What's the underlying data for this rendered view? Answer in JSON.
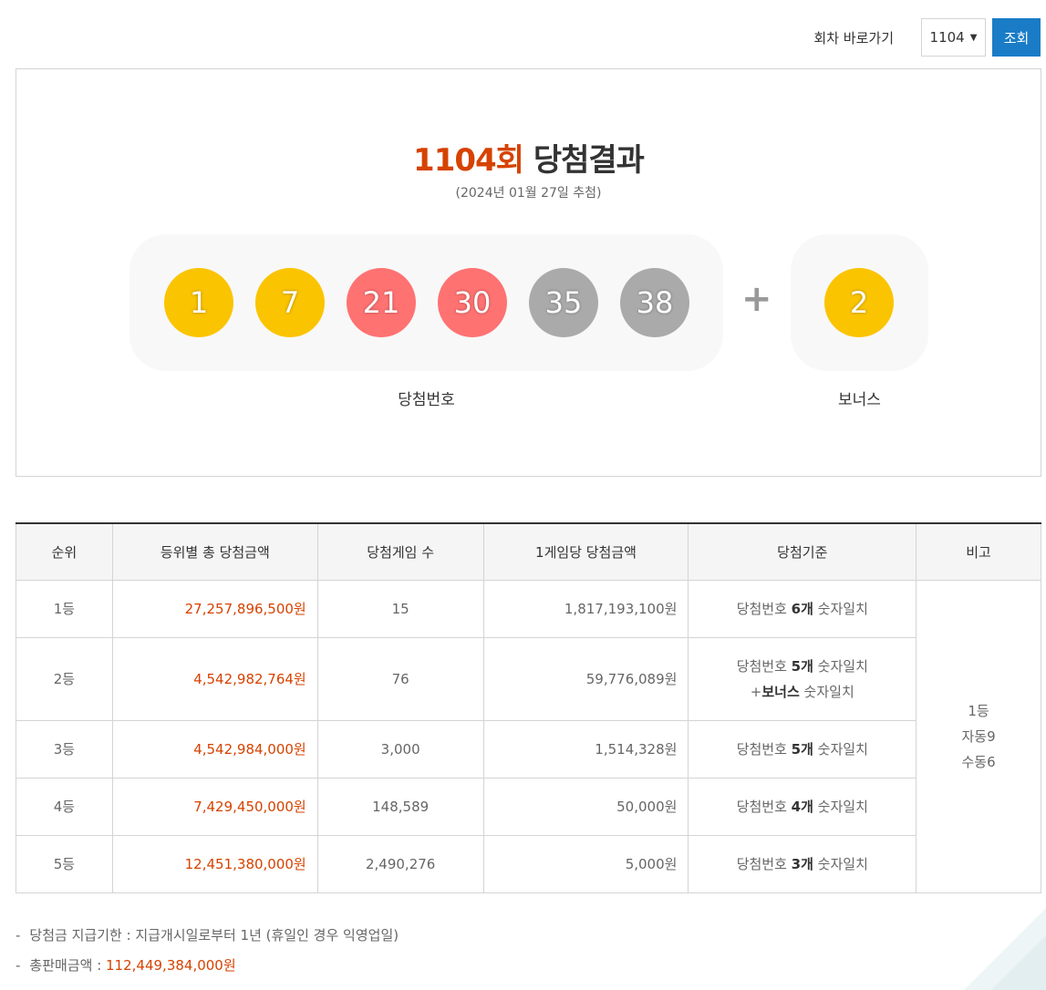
{
  "topbar": {
    "goto_label": "회차 바로가기",
    "selected_round": "1104",
    "search_label": "조회"
  },
  "result": {
    "round_text": "1104회",
    "title_suffix": "당첨결과",
    "draw_date": "(2024년 01월 27일 추첨)",
    "numbers": [
      "1",
      "7",
      "21",
      "30",
      "35",
      "38"
    ],
    "number_colors": [
      "#fbc400",
      "#fbc400",
      "#ff7272",
      "#ff7272",
      "#aaaaaa",
      "#aaaaaa"
    ],
    "bonus": "2",
    "bonus_color": "#fbc400",
    "plus": "+",
    "main_label": "당첨번호",
    "bonus_label": "보너스"
  },
  "table": {
    "headers": [
      "순위",
      "등위별 총 당첨금액",
      "당첨게임 수",
      "1게임당 당첨금액",
      "당첨기준",
      "비고"
    ],
    "rows": [
      {
        "rank": "1등",
        "total": "27,257,896,500원",
        "games": "15",
        "per_game": "1,817,193,100원",
        "crit_pre": "당첨번호 ",
        "crit_bold": "6개",
        "crit_post": " 숫자일치"
      },
      {
        "rank": "2등",
        "total": "4,542,982,764원",
        "games": "76",
        "per_game": "59,776,089원",
        "crit_pre": "당첨번호 ",
        "crit_bold": "5개",
        "crit_post": " 숫자일치",
        "crit2_pre": "+",
        "crit2_bold": "보너스",
        "crit2_post": " 숫자일치"
      },
      {
        "rank": "3등",
        "total": "4,542,984,000원",
        "games": "3,000",
        "per_game": "1,514,328원",
        "crit_pre": "당첨번호 ",
        "crit_bold": "5개",
        "crit_post": " 숫자일치"
      },
      {
        "rank": "4등",
        "total": "7,429,450,000원",
        "games": "148,589",
        "per_game": "50,000원",
        "crit_pre": "당첨번호 ",
        "crit_bold": "4개",
        "crit_post": " 숫자일치"
      },
      {
        "rank": "5등",
        "total": "12,451,380,000원",
        "games": "2,490,276",
        "per_game": "5,000원",
        "crit_pre": "당첨번호 ",
        "crit_bold": "3개",
        "crit_post": " 숫자일치"
      }
    ],
    "note_lines": [
      "1등",
      "자동9",
      "수동6"
    ]
  },
  "notes": {
    "dash": "-",
    "deadline_label": "당첨금 지급기한 : 지급개시일로부터 1년 (휴일인 경우 익영업일)",
    "sales_label": "총판매금액 : ",
    "sales_value": "112,449,384,000원"
  }
}
